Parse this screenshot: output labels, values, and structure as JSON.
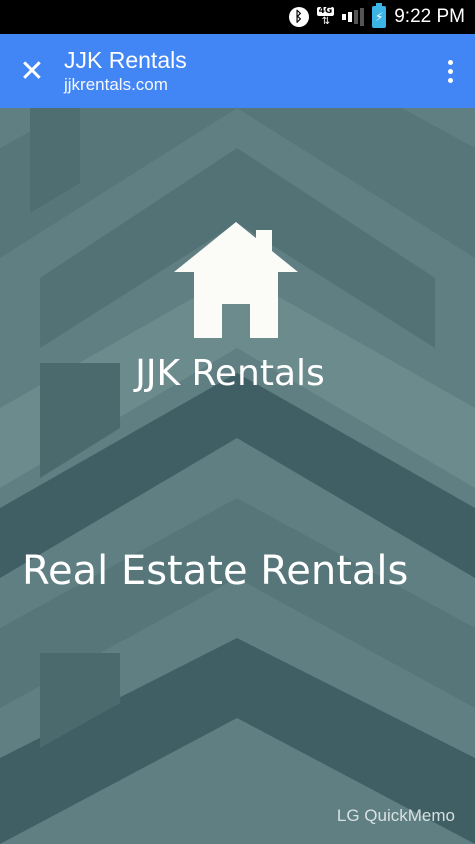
{
  "status_bar": {
    "bluetooth_icon": "bluetooth-icon",
    "network_label": "4G",
    "signal_icon": "signal-bars-icon",
    "battery_icon": "battery-charging-icon",
    "battery_color": "#3cb4e6",
    "time": "9:22 PM"
  },
  "app_bar": {
    "background_color": "#4285f4",
    "close_icon": "close-icon",
    "title": "JJK Rentals",
    "url": "jjkrentals.com",
    "menu_icon": "overflow-menu-icon"
  },
  "splash": {
    "background_color": "#5f7f82",
    "logo_icon": "house-icon",
    "brand_name": "JJK Rentals",
    "tagline": "Real Estate Rentals"
  },
  "watermark": {
    "text": "LG QuickMemo"
  }
}
